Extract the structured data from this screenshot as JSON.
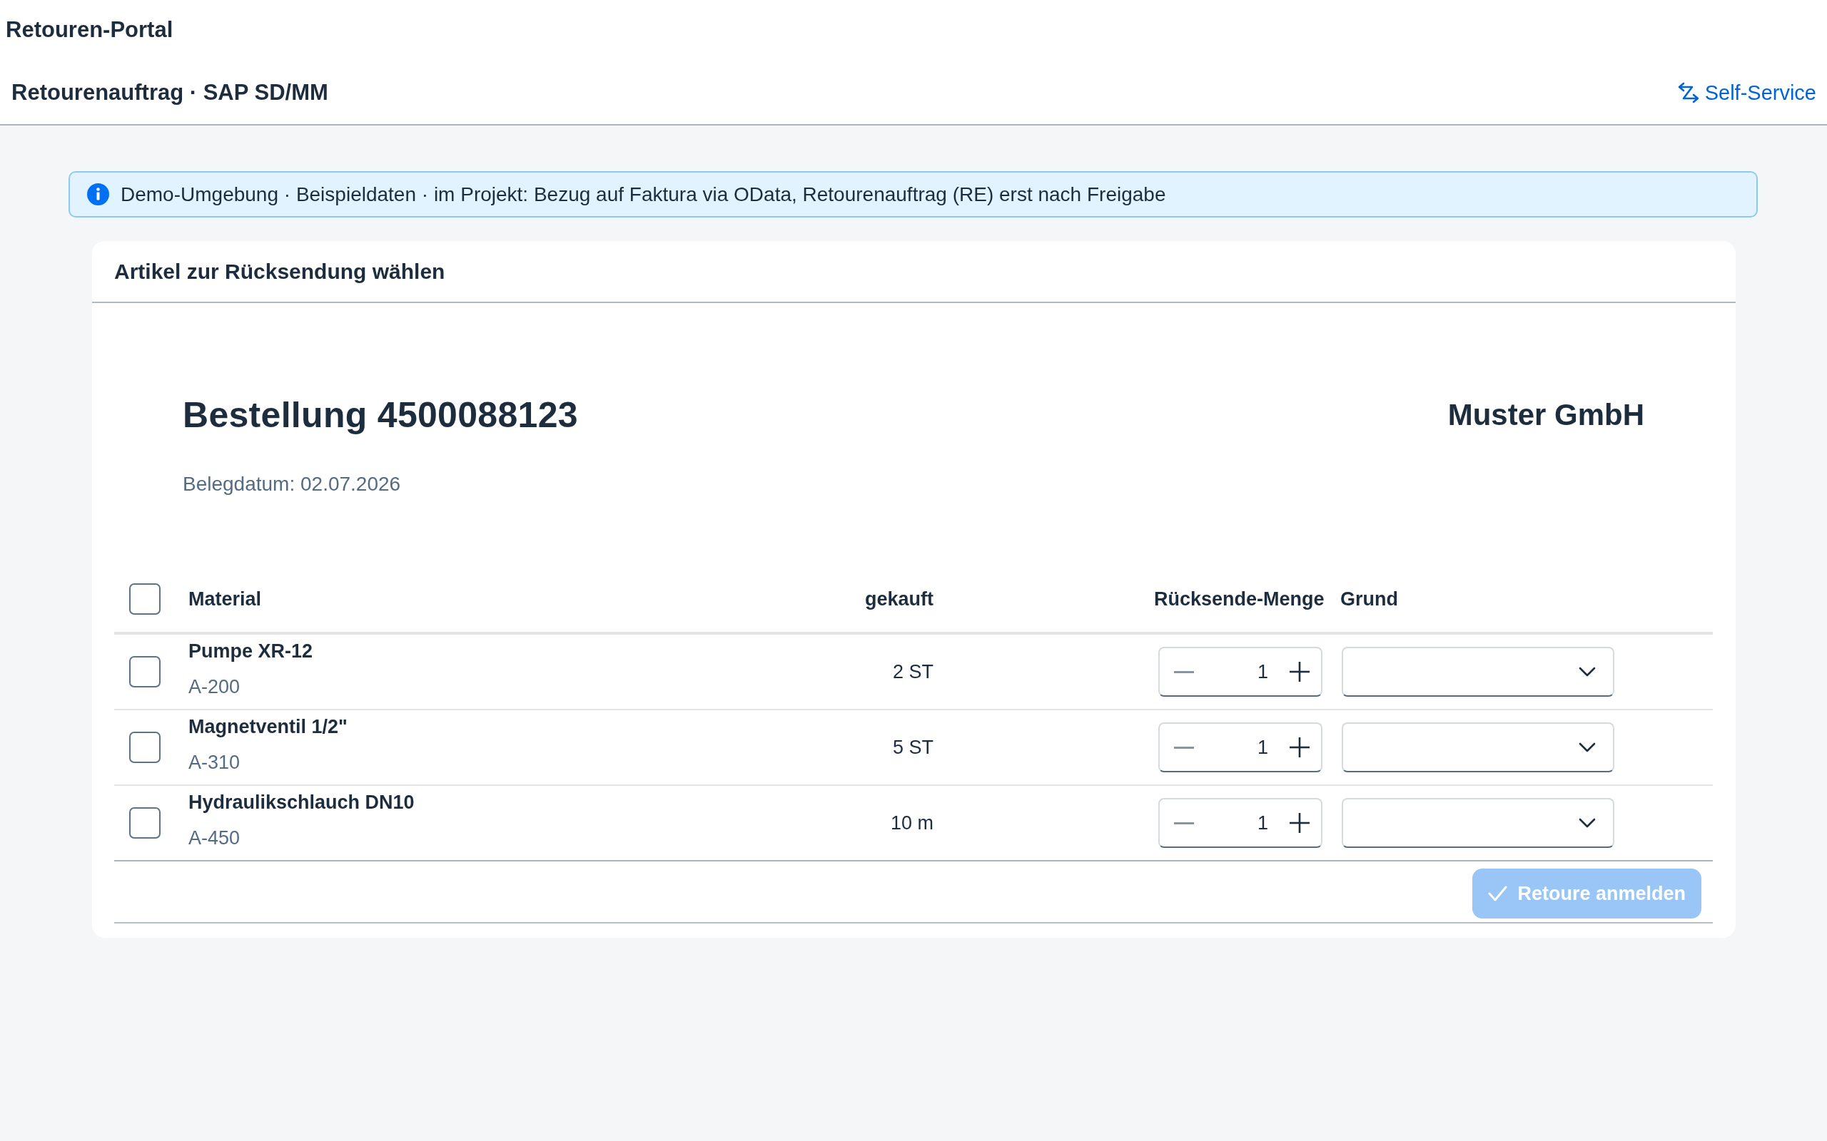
{
  "app_title": "Retouren-Portal",
  "page_bar": {
    "title": "Retourenauftrag · SAP SD/MM",
    "link": "Self-Service"
  },
  "banner": {
    "text": "Demo-Umgebung · Beispieldaten · im Projekt: Bezug auf Faktura via OData, Retourenauftrag (RE) erst nach Freigabe"
  },
  "card": {
    "title": "Artikel zur Rücksendung wählen",
    "order": {
      "title": "Bestellung 4500088123",
      "customer": "Muster GmbH",
      "date": "Belegdatum: 02.07.2026"
    },
    "table": {
      "select_all": {
        "checked": false
      },
      "columns": [
        "Material",
        "gekauft",
        "Rücksende-Menge",
        "Grund"
      ],
      "rows": [
        {
          "checked": false,
          "material": "Pumpe XR-12",
          "material_number": "A-200",
          "purchased": "2 ST",
          "quantity": "1",
          "decrease_disabled": true
        },
        {
          "checked": false,
          "material": "Magnetventil 1/2\"",
          "material_number": "A-310",
          "purchased": "5 ST",
          "quantity": "1",
          "decrease_disabled": true
        },
        {
          "checked": false,
          "material": "Hydraulikschlauch DN10",
          "material_number": "A-450",
          "purchased": "10 m",
          "quantity": "1",
          "decrease_disabled": true
        }
      ]
    },
    "submit": {
      "label": "Retoure anmelden",
      "disabled": true
    }
  }
}
